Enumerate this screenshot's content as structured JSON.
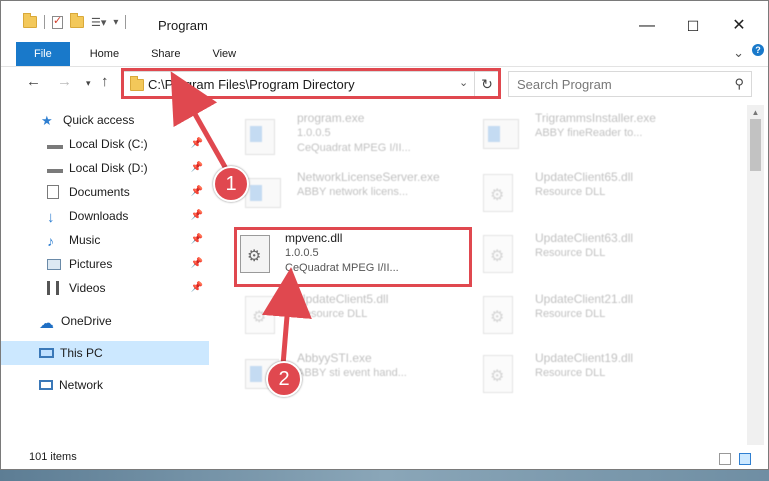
{
  "window": {
    "title": "Program"
  },
  "tabs": [
    "File",
    "Home",
    "Share",
    "View"
  ],
  "address": {
    "path": "C:\\Program Files\\Program Directory"
  },
  "search": {
    "placeholder": "Search Program"
  },
  "nav": {
    "items": [
      {
        "label": "Quick access",
        "icon": "star-icon"
      },
      {
        "label": "Local Disk (C:)",
        "icon": "drive-icon",
        "pinned": true
      },
      {
        "label": "Local Disk (D:)",
        "icon": "drive-icon",
        "pinned": true
      },
      {
        "label": "Documents",
        "icon": "documents-icon",
        "pinned": true
      },
      {
        "label": "Downloads",
        "icon": "download-icon",
        "pinned": true
      },
      {
        "label": "Music",
        "icon": "music-icon",
        "pinned": true
      },
      {
        "label": "Pictures",
        "icon": "pictures-icon",
        "pinned": true
      },
      {
        "label": "Videos",
        "icon": "videos-icon",
        "pinned": true
      },
      {
        "label": "OneDrive",
        "icon": "cloud-icon"
      },
      {
        "label": "This PC",
        "icon": "computer-icon",
        "selected": true
      },
      {
        "label": "Network",
        "icon": "network-icon"
      }
    ]
  },
  "files": [
    {
      "name": "program.exe",
      "version": "1.0.0.5",
      "desc": "CeQuadrat MPEG I/II...",
      "type": "exe"
    },
    {
      "name": "TrigrammsInstaller.exe",
      "version": "",
      "desc": "ABBY fineReader to...",
      "type": "exe"
    },
    {
      "name": "NetworkLicenseServer.exe",
      "version": "",
      "desc": "ABBY network licens...",
      "type": "exe"
    },
    {
      "name": "UpdateClient65.dll",
      "version": "",
      "desc": "Resource DLL",
      "type": "dll"
    },
    {
      "name": "mpvenc.dll",
      "version": "1.0.0.5",
      "desc": "CeQuadrat MPEG I/II...",
      "type": "dll"
    },
    {
      "name": "UpdateClient63.dll",
      "version": "",
      "desc": "Resource DLL",
      "type": "dll"
    },
    {
      "name": "UpdateClient5.dll",
      "version": "",
      "desc": "Resource DLL",
      "type": "dll"
    },
    {
      "name": "UpdateClient21.dll",
      "version": "",
      "desc": "Resource DLL",
      "type": "dll"
    },
    {
      "name": "AbbyySTI.exe",
      "version": "",
      "desc": "ABBY sti event hand...",
      "type": "exe"
    },
    {
      "name": "UpdateClient19.dll",
      "version": "",
      "desc": "Resource DLL",
      "type": "dll"
    }
  ],
  "status": {
    "item_count": "101 items"
  },
  "callouts": [
    "1",
    "2"
  ],
  "colors": {
    "accent": "#1979ca",
    "highlight": "#e0484f",
    "selected": "#cce8ff"
  }
}
